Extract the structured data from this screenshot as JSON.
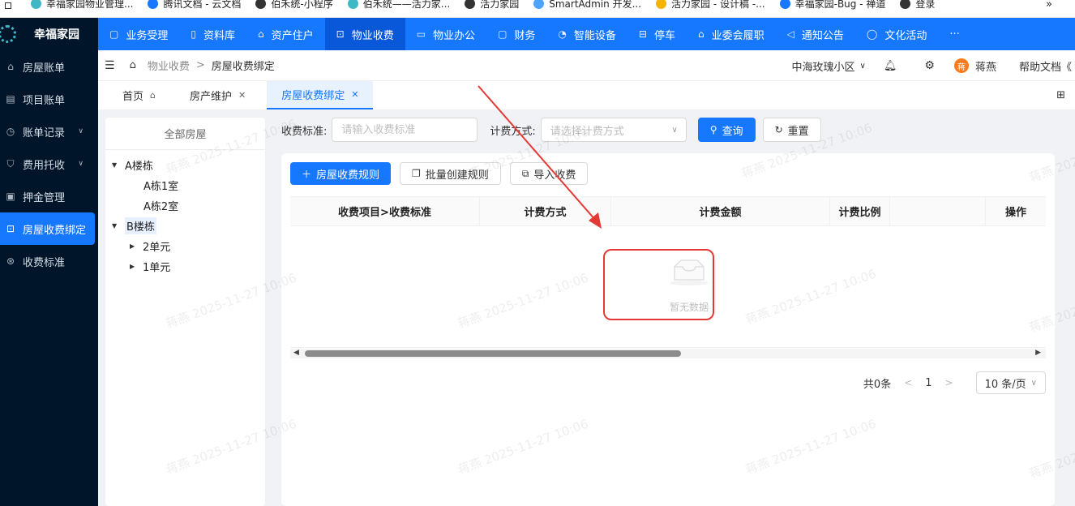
{
  "bookmarks": [
    {
      "label": "幸福家园物业管理...",
      "color": "#3fb8c6"
    },
    {
      "label": "腾讯文档 - 云文档",
      "color": "#1677ff"
    },
    {
      "label": "伯禾统-小程序",
      "color": "#333333"
    },
    {
      "label": "伯禾统——活力家...",
      "color": "#3fb8c6"
    },
    {
      "label": "活力家园",
      "color": "#333333"
    },
    {
      "label": "SmartAdmin 开发...",
      "color": "#4da3ff"
    },
    {
      "label": "活力家园 - 设计稿 -...",
      "color": "#f5b400"
    },
    {
      "label": "幸福家园-Bug - 禅道",
      "color": "#1677ff"
    },
    {
      "label": "登录",
      "color": "#333333"
    }
  ],
  "bookmarks_more": "»",
  "app": {
    "name": "幸福家园"
  },
  "sidebar": {
    "items": [
      {
        "label": "房屋账单",
        "icon": "home-icon",
        "glyph": "⌂",
        "chevron": false
      },
      {
        "label": "项目账单",
        "icon": "document-icon",
        "glyph": "▤",
        "chevron": false
      },
      {
        "label": "账单记录",
        "icon": "clock-icon",
        "glyph": "◷",
        "chevron": true
      },
      {
        "label": "费用托收",
        "icon": "shield-icon",
        "glyph": "⛉",
        "chevron": true
      },
      {
        "label": "押金管理",
        "icon": "wallet-icon",
        "glyph": "▣",
        "chevron": false
      },
      {
        "label": "房屋收费绑定",
        "icon": "link-icon",
        "glyph": "⊡",
        "chevron": false,
        "active": true
      },
      {
        "label": "收费标准",
        "icon": "settings-icon",
        "glyph": "⊛",
        "chevron": false
      }
    ]
  },
  "topnav": {
    "items": [
      {
        "label": "业务受理",
        "glyph": "▢"
      },
      {
        "label": "资料库",
        "glyph": "▯"
      },
      {
        "label": "资产住户",
        "glyph": "⌂"
      },
      {
        "label": "物业收费",
        "glyph": "⊡",
        "active": true
      },
      {
        "label": "物业办公",
        "glyph": "▭"
      },
      {
        "label": "财务",
        "glyph": "▢"
      },
      {
        "label": "智能设备",
        "glyph": "◔"
      },
      {
        "label": "停车",
        "glyph": "⊟"
      },
      {
        "label": "业委会履职",
        "glyph": "⌂"
      },
      {
        "label": "通知公告",
        "glyph": "◁"
      },
      {
        "label": "文化活动",
        "glyph": "◯"
      },
      {
        "label": "···",
        "glyph": ""
      }
    ]
  },
  "header": {
    "breadcrumb": [
      "物业收费",
      "房屋收费绑定"
    ],
    "breadcrumb_sep": ">",
    "community": "中海玫瑰小区",
    "user_avatar": "蒋",
    "user_name": "蒋燕",
    "help": "帮助文档"
  },
  "tabs": [
    {
      "label": "首页",
      "icon": "home-icon",
      "glyph": "⌂"
    },
    {
      "label": "房产维护",
      "icon": "close-icon",
      "glyph": "✕"
    },
    {
      "label": "房屋收费绑定",
      "icon": "close-icon",
      "glyph": "✕",
      "active": true
    }
  ],
  "tree": {
    "title": "全部房屋",
    "nodes": [
      {
        "label": "A楼栋",
        "level": 0,
        "expanded": true
      },
      {
        "label": "A栋1室",
        "level": 2
      },
      {
        "label": "A栋2室",
        "level": 2
      },
      {
        "label": "B楼栋",
        "level": 0,
        "expanded": true,
        "selected": true
      },
      {
        "label": "2单元",
        "level": 1,
        "expanded": false
      },
      {
        "label": "1单元",
        "level": 1,
        "expanded": false
      }
    ]
  },
  "filters": {
    "standard_label": "收费标准:",
    "standard_placeholder": "请输入收费标准",
    "method_label": "计费方式:",
    "method_placeholder": "请选择计费方式",
    "search_btn": "查询",
    "reset_btn": "重置"
  },
  "toolbar": {
    "add_btn": "房屋收费规则",
    "batch_btn": "批量创建规则",
    "import_btn": "导入收费"
  },
  "table": {
    "columns": [
      "收费项目>收费标准",
      "计费方式",
      "计费金额",
      "计费比例",
      "",
      "操作"
    ],
    "rows": [],
    "empty_text": "暂无数据"
  },
  "pagination": {
    "total": "共0条",
    "prev": "<",
    "current": "1",
    "next": ">",
    "page_size": "10 条/页"
  },
  "watermark": "蒋燕 2025-11-27 10:06",
  "colors": {
    "accent": "#1677ff",
    "sidebar_bg": "#001529",
    "annotation_red": "#e53935"
  }
}
